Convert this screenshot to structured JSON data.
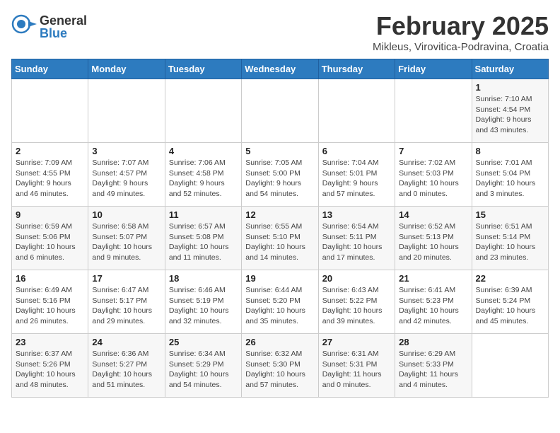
{
  "header": {
    "logo": {
      "general": "General",
      "blue": "Blue"
    },
    "title": "February 2025",
    "subtitle": "Mikleus, Virovitica-Podravina, Croatia"
  },
  "weekdays": [
    "Sunday",
    "Monday",
    "Tuesday",
    "Wednesday",
    "Thursday",
    "Friday",
    "Saturday"
  ],
  "weeks": [
    [
      {
        "day": "",
        "info": ""
      },
      {
        "day": "",
        "info": ""
      },
      {
        "day": "",
        "info": ""
      },
      {
        "day": "",
        "info": ""
      },
      {
        "day": "",
        "info": ""
      },
      {
        "day": "",
        "info": ""
      },
      {
        "day": "1",
        "info": "Sunrise: 7:10 AM\nSunset: 4:54 PM\nDaylight: 9 hours\nand 43 minutes."
      }
    ],
    [
      {
        "day": "2",
        "info": "Sunrise: 7:09 AM\nSunset: 4:55 PM\nDaylight: 9 hours\nand 46 minutes."
      },
      {
        "day": "3",
        "info": "Sunrise: 7:07 AM\nSunset: 4:57 PM\nDaylight: 9 hours\nand 49 minutes."
      },
      {
        "day": "4",
        "info": "Sunrise: 7:06 AM\nSunset: 4:58 PM\nDaylight: 9 hours\nand 52 minutes."
      },
      {
        "day": "5",
        "info": "Sunrise: 7:05 AM\nSunset: 5:00 PM\nDaylight: 9 hours\nand 54 minutes."
      },
      {
        "day": "6",
        "info": "Sunrise: 7:04 AM\nSunset: 5:01 PM\nDaylight: 9 hours\nand 57 minutes."
      },
      {
        "day": "7",
        "info": "Sunrise: 7:02 AM\nSunset: 5:03 PM\nDaylight: 10 hours\nand 0 minutes."
      },
      {
        "day": "8",
        "info": "Sunrise: 7:01 AM\nSunset: 5:04 PM\nDaylight: 10 hours\nand 3 minutes."
      }
    ],
    [
      {
        "day": "9",
        "info": "Sunrise: 6:59 AM\nSunset: 5:06 PM\nDaylight: 10 hours\nand 6 minutes."
      },
      {
        "day": "10",
        "info": "Sunrise: 6:58 AM\nSunset: 5:07 PM\nDaylight: 10 hours\nand 9 minutes."
      },
      {
        "day": "11",
        "info": "Sunrise: 6:57 AM\nSunset: 5:08 PM\nDaylight: 10 hours\nand 11 minutes."
      },
      {
        "day": "12",
        "info": "Sunrise: 6:55 AM\nSunset: 5:10 PM\nDaylight: 10 hours\nand 14 minutes."
      },
      {
        "day": "13",
        "info": "Sunrise: 6:54 AM\nSunset: 5:11 PM\nDaylight: 10 hours\nand 17 minutes."
      },
      {
        "day": "14",
        "info": "Sunrise: 6:52 AM\nSunset: 5:13 PM\nDaylight: 10 hours\nand 20 minutes."
      },
      {
        "day": "15",
        "info": "Sunrise: 6:51 AM\nSunset: 5:14 PM\nDaylight: 10 hours\nand 23 minutes."
      }
    ],
    [
      {
        "day": "16",
        "info": "Sunrise: 6:49 AM\nSunset: 5:16 PM\nDaylight: 10 hours\nand 26 minutes."
      },
      {
        "day": "17",
        "info": "Sunrise: 6:47 AM\nSunset: 5:17 PM\nDaylight: 10 hours\nand 29 minutes."
      },
      {
        "day": "18",
        "info": "Sunrise: 6:46 AM\nSunset: 5:19 PM\nDaylight: 10 hours\nand 32 minutes."
      },
      {
        "day": "19",
        "info": "Sunrise: 6:44 AM\nSunset: 5:20 PM\nDaylight: 10 hours\nand 35 minutes."
      },
      {
        "day": "20",
        "info": "Sunrise: 6:43 AM\nSunset: 5:22 PM\nDaylight: 10 hours\nand 39 minutes."
      },
      {
        "day": "21",
        "info": "Sunrise: 6:41 AM\nSunset: 5:23 PM\nDaylight: 10 hours\nand 42 minutes."
      },
      {
        "day": "22",
        "info": "Sunrise: 6:39 AM\nSunset: 5:24 PM\nDaylight: 10 hours\nand 45 minutes."
      }
    ],
    [
      {
        "day": "23",
        "info": "Sunrise: 6:37 AM\nSunset: 5:26 PM\nDaylight: 10 hours\nand 48 minutes."
      },
      {
        "day": "24",
        "info": "Sunrise: 6:36 AM\nSunset: 5:27 PM\nDaylight: 10 hours\nand 51 minutes."
      },
      {
        "day": "25",
        "info": "Sunrise: 6:34 AM\nSunset: 5:29 PM\nDaylight: 10 hours\nand 54 minutes."
      },
      {
        "day": "26",
        "info": "Sunrise: 6:32 AM\nSunset: 5:30 PM\nDaylight: 10 hours\nand 57 minutes."
      },
      {
        "day": "27",
        "info": "Sunrise: 6:31 AM\nSunset: 5:31 PM\nDaylight: 11 hours\nand 0 minutes."
      },
      {
        "day": "28",
        "info": "Sunrise: 6:29 AM\nSunset: 5:33 PM\nDaylight: 11 hours\nand 4 minutes."
      },
      {
        "day": "",
        "info": ""
      }
    ]
  ]
}
